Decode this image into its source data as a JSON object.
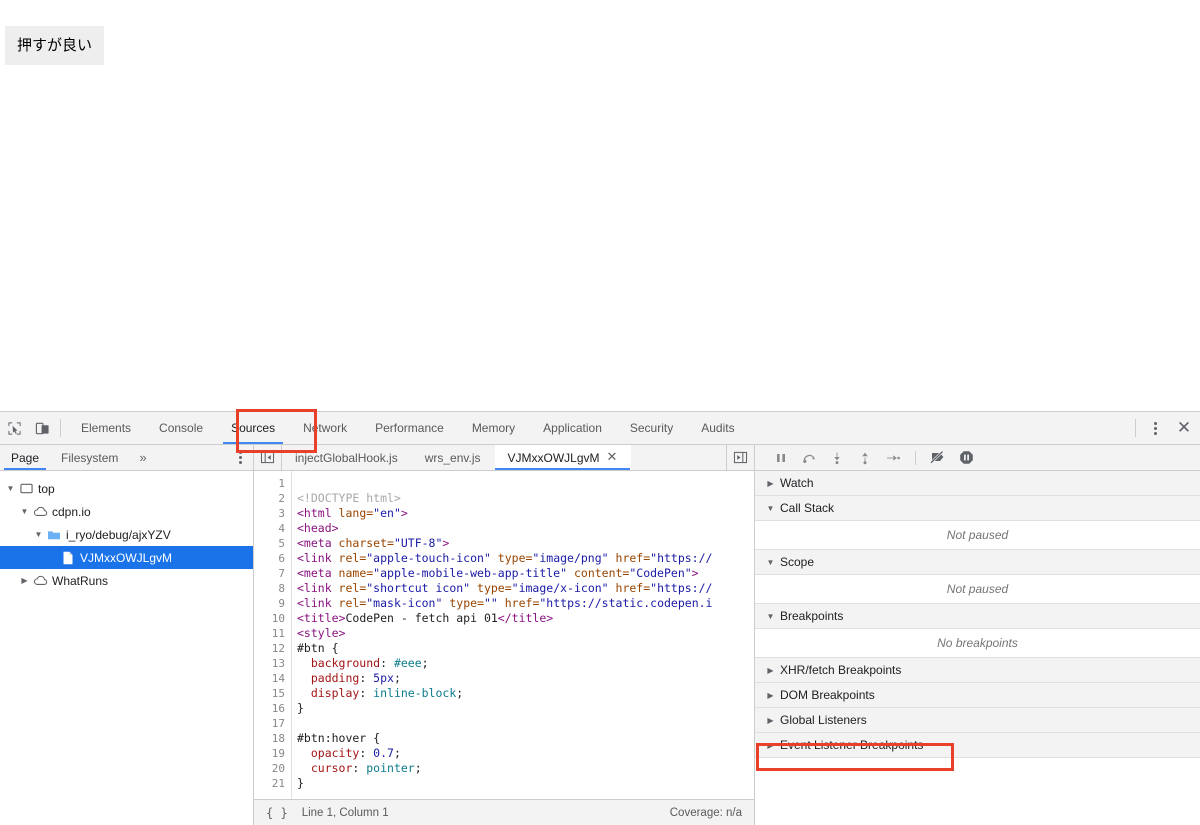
{
  "page": {
    "button_label": "押すが良い"
  },
  "devtools": {
    "toolbar_icons": {
      "inspect": "inspect-element-icon",
      "device": "device-toolbar-icon"
    },
    "tabs": [
      {
        "label": "Elements",
        "active": false
      },
      {
        "label": "Console",
        "active": false
      },
      {
        "label": "Sources",
        "active": true
      },
      {
        "label": "Network",
        "active": false
      },
      {
        "label": "Performance",
        "active": false
      },
      {
        "label": "Memory",
        "active": false
      },
      {
        "label": "Application",
        "active": false
      },
      {
        "label": "Security",
        "active": false
      },
      {
        "label": "Audits",
        "active": false
      }
    ],
    "more_options_icon": "kebab-menu-icon",
    "close_label": "✕",
    "annotations": [
      {
        "target": "Sources",
        "color": "#e8402a"
      },
      {
        "target": "Event Listener Breakpoints",
        "color": "#e8402a"
      }
    ]
  },
  "navigator": {
    "tabs": [
      {
        "label": "Page",
        "active": true
      },
      {
        "label": "Filesystem",
        "active": false
      }
    ],
    "overflow_label": "»",
    "more_options_icon": "kebab-menu-icon",
    "tree": [
      {
        "label": "top",
        "icon": "frame-icon",
        "twisty": "▼",
        "indent": 0,
        "selected": false
      },
      {
        "label": "cdpn.io",
        "icon": "cloud-icon",
        "twisty": "▼",
        "indent": 1,
        "selected": false
      },
      {
        "label": "i_ryo/debug/ajxYZV",
        "icon": "folder-icon",
        "twisty": "▼",
        "indent": 2,
        "selected": false
      },
      {
        "label": "VJMxxOWJLgvM",
        "icon": "document-icon",
        "twisty": "",
        "indent": 3,
        "selected": true
      },
      {
        "label": "WhatRuns",
        "icon": "cloud-icon",
        "twisty": "▶",
        "indent": 1,
        "selected": false
      }
    ]
  },
  "editor": {
    "scroll_left_icon": "scroll-tabs-left-icon",
    "scroll_right_icon": "scroll-tabs-right-icon",
    "file_tabs": [
      {
        "label": "injectGlobalHook.js",
        "active": false,
        "closable": false
      },
      {
        "label": "wrs_env.js",
        "active": false,
        "closable": false
      },
      {
        "label": "VJMxxOWJLgvM",
        "active": true,
        "closable": true,
        "close_label": "✕"
      }
    ],
    "lines": [
      {
        "n": 1,
        "tokens": []
      },
      {
        "n": 2,
        "tokens": [
          {
            "t": "dtd",
            "s": "<!DOCTYPE html>"
          }
        ]
      },
      {
        "n": 3,
        "tokens": [
          {
            "t": "tag",
            "s": "<html "
          },
          {
            "t": "attr",
            "s": "lang="
          },
          {
            "t": "val",
            "s": "\"en\""
          },
          {
            "t": "tag",
            "s": ">"
          }
        ]
      },
      {
        "n": 4,
        "tokens": [
          {
            "t": "tag",
            "s": "<head>"
          }
        ]
      },
      {
        "n": 5,
        "tokens": [
          {
            "t": "tag",
            "s": "<meta "
          },
          {
            "t": "attr",
            "s": "charset="
          },
          {
            "t": "val",
            "s": "\"UTF-8\""
          },
          {
            "t": "tag",
            "s": ">"
          }
        ]
      },
      {
        "n": 6,
        "tokens": [
          {
            "t": "tag",
            "s": "<link "
          },
          {
            "t": "attr",
            "s": "rel="
          },
          {
            "t": "val",
            "s": "\"apple-touch-icon\""
          },
          {
            "t": "attr",
            "s": " type="
          },
          {
            "t": "val",
            "s": "\"image/png\""
          },
          {
            "t": "attr",
            "s": " href="
          },
          {
            "t": "val",
            "s": "\"https://"
          }
        ]
      },
      {
        "n": 7,
        "tokens": [
          {
            "t": "tag",
            "s": "<meta "
          },
          {
            "t": "attr",
            "s": "name="
          },
          {
            "t": "val",
            "s": "\"apple-mobile-web-app-title\""
          },
          {
            "t": "attr",
            "s": " content="
          },
          {
            "t": "val",
            "s": "\"CodePen\""
          },
          {
            "t": "tag",
            "s": ">"
          }
        ]
      },
      {
        "n": 8,
        "tokens": [
          {
            "t": "tag",
            "s": "<link "
          },
          {
            "t": "attr",
            "s": "rel="
          },
          {
            "t": "val",
            "s": "\"shortcut icon\""
          },
          {
            "t": "attr",
            "s": " type="
          },
          {
            "t": "val",
            "s": "\"image/x-icon\""
          },
          {
            "t": "attr",
            "s": " href="
          },
          {
            "t": "val",
            "s": "\"https://"
          }
        ]
      },
      {
        "n": 9,
        "tokens": [
          {
            "t": "tag",
            "s": "<link "
          },
          {
            "t": "attr",
            "s": "rel="
          },
          {
            "t": "val",
            "s": "\"mask-icon\""
          },
          {
            "t": "attr",
            "s": " type="
          },
          {
            "t": "val",
            "s": "\"\""
          },
          {
            "t": "attr",
            "s": " href="
          },
          {
            "t": "val",
            "s": "\"https://static.codepen.i"
          }
        ]
      },
      {
        "n": 10,
        "tokens": [
          {
            "t": "tag",
            "s": "<title>"
          },
          {
            "t": "txt",
            "s": "CodePen - fetch api 01"
          },
          {
            "t": "tag",
            "s": "</title>"
          }
        ]
      },
      {
        "n": 11,
        "tokens": [
          {
            "t": "tag",
            "s": "<style>"
          }
        ]
      },
      {
        "n": 12,
        "tokens": [
          {
            "t": "sel",
            "s": "#btn {"
          }
        ]
      },
      {
        "n": 13,
        "tokens": [
          {
            "t": "prop",
            "s": "  background"
          },
          {
            "t": "punc",
            "s": ": "
          },
          {
            "t": "pval",
            "s": "#eee"
          },
          {
            "t": "punc",
            "s": ";"
          }
        ]
      },
      {
        "n": 14,
        "tokens": [
          {
            "t": "prop",
            "s": "  padding"
          },
          {
            "t": "punc",
            "s": ": "
          },
          {
            "t": "num",
            "s": "5px"
          },
          {
            "t": "punc",
            "s": ";"
          }
        ]
      },
      {
        "n": 15,
        "tokens": [
          {
            "t": "prop",
            "s": "  display"
          },
          {
            "t": "punc",
            "s": ": "
          },
          {
            "t": "pval",
            "s": "inline-block"
          },
          {
            "t": "punc",
            "s": ";"
          }
        ]
      },
      {
        "n": 16,
        "tokens": [
          {
            "t": "sel",
            "s": "}"
          }
        ]
      },
      {
        "n": 17,
        "tokens": []
      },
      {
        "n": 18,
        "tokens": [
          {
            "t": "sel",
            "s": "#btn:hover {"
          }
        ]
      },
      {
        "n": 19,
        "tokens": [
          {
            "t": "prop",
            "s": "  opacity"
          },
          {
            "t": "punc",
            "s": ": "
          },
          {
            "t": "num",
            "s": "0.7"
          },
          {
            "t": "punc",
            "s": ";"
          }
        ]
      },
      {
        "n": 20,
        "tokens": [
          {
            "t": "prop",
            "s": "  cursor"
          },
          {
            "t": "punc",
            "s": ": "
          },
          {
            "t": "pval",
            "s": "pointer"
          },
          {
            "t": "punc",
            "s": ";"
          }
        ]
      },
      {
        "n": 21,
        "tokens": [
          {
            "t": "sel",
            "s": "}"
          }
        ]
      }
    ],
    "status": {
      "pretty_print_label": "{ }",
      "cursor_position": "Line 1, Column 1",
      "coverage": "Coverage: n/a"
    }
  },
  "debugger": {
    "controls": [
      {
        "name": "resume-pause-button",
        "title": "pause"
      },
      {
        "name": "step-over-button",
        "title": "step-over"
      },
      {
        "name": "step-into-button",
        "title": "step-into"
      },
      {
        "name": "step-out-button",
        "title": "step-out"
      },
      {
        "name": "step-button",
        "title": "step"
      },
      {
        "name": "deactivate-breakpoints-button",
        "title": "deactivate-breakpoints"
      },
      {
        "name": "pause-on-exceptions-button",
        "title": "pause-on-exceptions"
      }
    ],
    "panels": [
      {
        "label": "Watch",
        "expanded": false,
        "twisty": "▶",
        "empty": null,
        "highlighted": false
      },
      {
        "label": "Call Stack",
        "expanded": true,
        "twisty": "▼",
        "empty": "Not paused",
        "highlighted": false
      },
      {
        "label": "Scope",
        "expanded": true,
        "twisty": "▼",
        "empty": "Not paused",
        "highlighted": false
      },
      {
        "label": "Breakpoints",
        "expanded": true,
        "twisty": "▼",
        "empty": "No breakpoints",
        "highlighted": false
      },
      {
        "label": "XHR/fetch Breakpoints",
        "expanded": false,
        "twisty": "▶",
        "empty": null,
        "highlighted": false
      },
      {
        "label": "DOM Breakpoints",
        "expanded": false,
        "twisty": "▶",
        "empty": null,
        "highlighted": false
      },
      {
        "label": "Global Listeners",
        "expanded": false,
        "twisty": "▶",
        "empty": null,
        "highlighted": false
      },
      {
        "label": "Event Listener Breakpoints",
        "expanded": false,
        "twisty": "▶",
        "empty": null,
        "highlighted": true
      }
    ]
  },
  "colors": {
    "accent": "#4285f4",
    "selection": "#1a73e8",
    "annotation": "#e8402a",
    "chrome_bg": "#f3f3f3"
  }
}
